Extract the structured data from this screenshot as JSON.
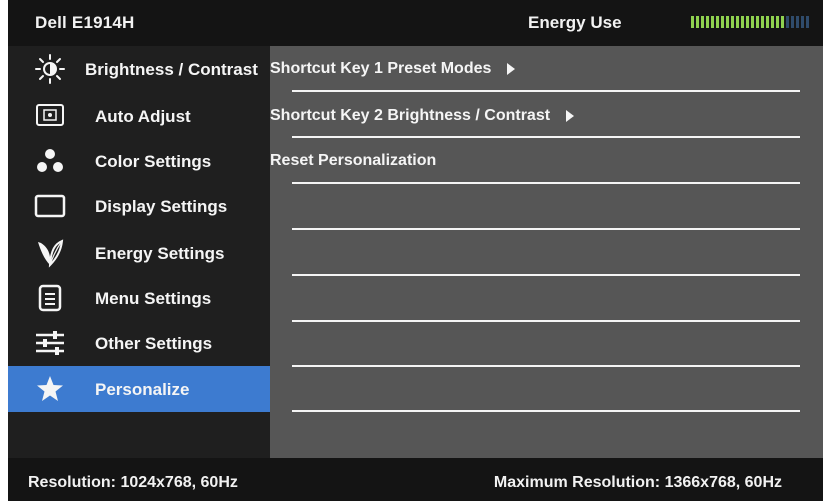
{
  "header": {
    "monitor_model": "Dell E1914H",
    "energy_label": "Energy Use",
    "energy_level": 0.8
  },
  "sidebar": {
    "items": [
      {
        "label": "Brightness / Contrast",
        "icon": "brightness-icon"
      },
      {
        "label": "Auto Adjust",
        "icon": "auto-adjust-icon"
      },
      {
        "label": "Color Settings",
        "icon": "color-settings-icon"
      },
      {
        "label": "Display Settings",
        "icon": "display-settings-icon"
      },
      {
        "label": "Energy Settings",
        "icon": "energy-settings-icon"
      },
      {
        "label": "Menu Settings",
        "icon": "menu-settings-icon"
      },
      {
        "label": "Other Settings",
        "icon": "other-settings-icon"
      },
      {
        "label": "Personalize",
        "icon": "star-icon",
        "selected": true
      }
    ]
  },
  "content": {
    "rows": [
      {
        "label": "Shortcut Key 1 Preset Modes",
        "has_arrow": true
      },
      {
        "label": "Shortcut Key 2 Brightness / Contrast",
        "has_arrow": true
      },
      {
        "label": "Reset Personalization",
        "has_arrow": false
      }
    ]
  },
  "footer": {
    "resolution": "Resolution: 1024x768, 60Hz",
    "max_resolution": "Maximum Resolution: 1366x768, 60Hz"
  },
  "colors": {
    "selected_background": "#3d7bd0",
    "content_background": "#565656",
    "sidebar_background": "#1f1f1f",
    "energy_meter_on": "#8fd14f",
    "energy_meter_off": "#2f4b6b"
  }
}
